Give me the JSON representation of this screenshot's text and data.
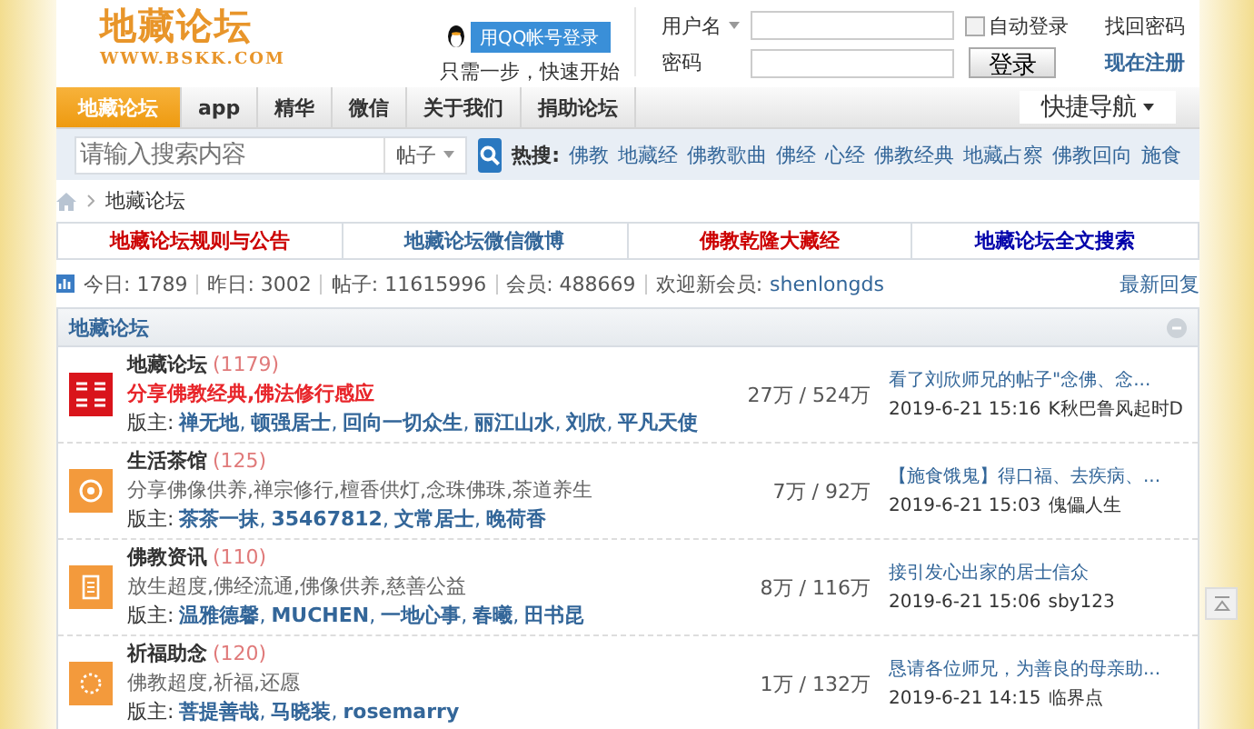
{
  "logo": {
    "title": "地藏论坛",
    "url": "WWW.BSKK.COM"
  },
  "qq_login": {
    "button": "用QQ帐号登录",
    "hint": "只需一步，快速开始"
  },
  "login": {
    "username_label": "用户名",
    "password_label": "密码",
    "remember": {
      "label": "自动登录",
      "checked": false
    },
    "forgot": "找回密码",
    "submit": "登录",
    "register": "现在注册"
  },
  "nav": {
    "items": [
      {
        "label": "地藏论坛",
        "selected": true
      },
      {
        "label": "app",
        "selected": false
      },
      {
        "label": "精华",
        "selected": false
      },
      {
        "label": "微信",
        "selected": false
      },
      {
        "label": "关于我们",
        "selected": false
      },
      {
        "label": "捐助论坛",
        "selected": false
      }
    ],
    "quick_nav": "快捷导航"
  },
  "search": {
    "placeholder": "请输入搜索内容",
    "scope": "帖子",
    "hot_label": "热搜:",
    "hot": [
      "佛教",
      "地藏经",
      "佛教歌曲",
      "佛经",
      "心经",
      "佛教经典",
      "地藏占察",
      "佛教回向",
      "施食"
    ]
  },
  "breadcrumb": {
    "current": "地藏论坛"
  },
  "quick_links": [
    {
      "label": "地藏论坛规则与公告",
      "color": "#cc0000"
    },
    {
      "label": "地藏论坛微信微博",
      "color": "#336699"
    },
    {
      "label": "佛教乾隆大藏经",
      "color": "#cc0000"
    },
    {
      "label": "地藏论坛全文搜索",
      "color": "#0000aa"
    }
  ],
  "stats": {
    "items": [
      "今日: 1789",
      "昨日: 3002",
      "帖子: 11615996",
      "会员: 488669"
    ],
    "welcome_label": "欢迎新会员:",
    "new_member": "shenlongds",
    "latest": "最新回复"
  },
  "forum_group": {
    "title": "地藏论坛",
    "collapsed": false
  },
  "forums": [
    {
      "kind": "logo",
      "name": "地藏论坛",
      "count": "(1179)",
      "description": "分享佛教经典,佛法修行感应",
      "highlight": true,
      "moderators_label": "版主:",
      "moderator_separator": ",",
      "moderators": [
        "禅无地",
        "顿强居士",
        "回向一切众生",
        "丽江山水",
        "刘欣",
        "平凡天使"
      ],
      "stats": "27万 / 524万",
      "last_post": {
        "title": "看了刘欣师兄的帖子\"念佛、念...",
        "time": "2019-6-21 15:16",
        "user": "K秋巴鲁风起时D"
      }
    },
    {
      "kind": "target",
      "name": "生活茶馆",
      "count": "(125)",
      "description": "分享佛像供养,禅宗修行,檀香供灯,念珠佛珠,茶道养生",
      "highlight": false,
      "moderators_label": "版主:",
      "moderator_separator": ",",
      "moderators": [
        "茶茶一抹",
        "35467812",
        "文常居士",
        "晚荷香"
      ],
      "stats": "7万 / 92万",
      "last_post": {
        "title": "【施食饿鬼】得口福、去疾病、...",
        "time": "2019-6-21 15:03",
        "user": "傀儡人生"
      }
    },
    {
      "kind": "document",
      "name": "佛教资讯",
      "count": "(110)",
      "description": "放生超度,佛经流通,佛像供养,慈善公益",
      "highlight": false,
      "moderators_label": "版主:",
      "moderator_separator": ",",
      "moderators": [
        "温雅德馨",
        "MUCHEN",
        "一地心事",
        "春曦",
        "田书昆"
      ],
      "stats": "8万 / 116万",
      "last_post": {
        "title": "接引发心出家的居士信众",
        "time": "2019-6-21 15:06",
        "user": "sby123"
      }
    },
    {
      "kind": "sun",
      "name": "祈福助念",
      "count": "(120)",
      "description": "佛教超度,祈福,还愿",
      "highlight": false,
      "moderators_label": "版主:",
      "moderator_separator": ",",
      "moderators": [
        "菩提善哉",
        "马晓装",
        "rosemarry"
      ],
      "stats": "1万 / 132万",
      "last_post": {
        "title": "恳请各位师兄，为善良的母亲助...",
        "time": "2019-6-21 14:15",
        "user": "临界点"
      }
    }
  ]
}
